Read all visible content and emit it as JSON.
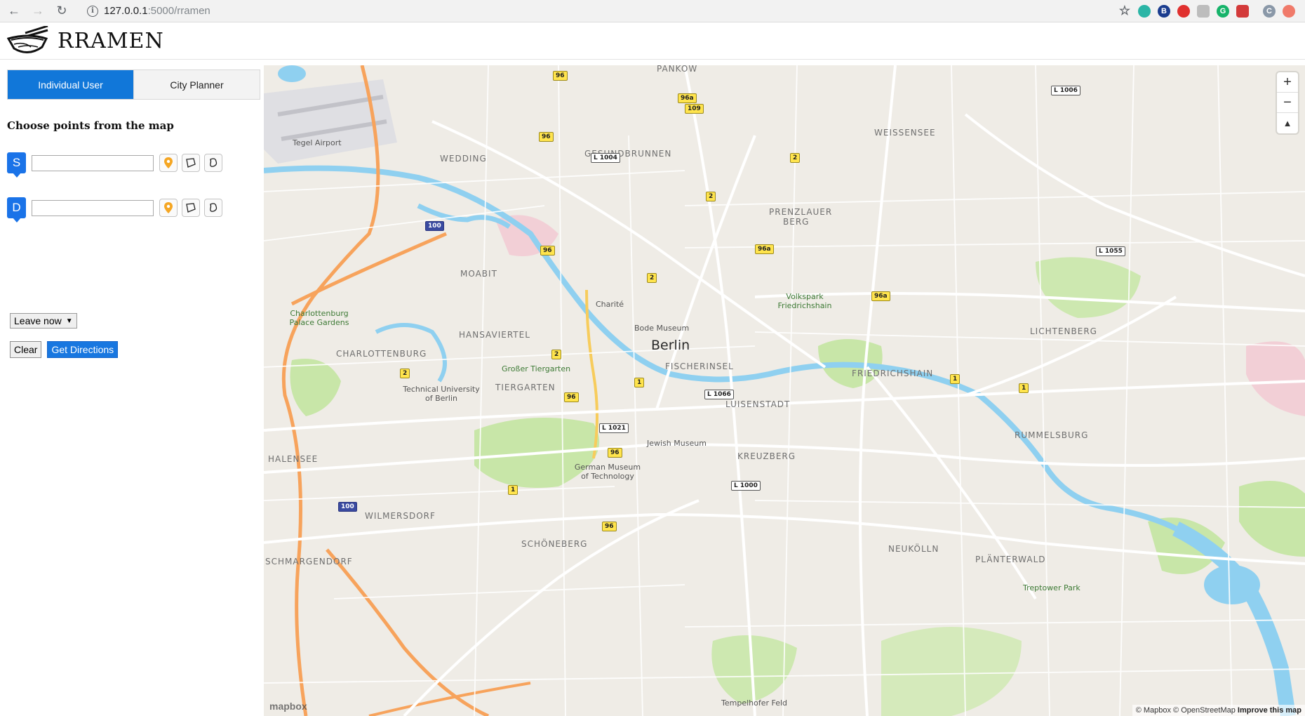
{
  "browser": {
    "url_host": "127.0.0.1",
    "url_path": ":5000/rramen",
    "profile_initial": "C"
  },
  "app": {
    "title": "RRAMEN"
  },
  "sidebar": {
    "tabs": [
      {
        "label": "Individual User"
      },
      {
        "label": "City Planner"
      }
    ],
    "section_title": "Choose points from the map",
    "start": {
      "marker": "S",
      "value": "",
      "placeholder": ""
    },
    "destination": {
      "marker": "D",
      "value": "",
      "placeholder": ""
    },
    "time_select": {
      "value": "Leave now"
    },
    "clear_label": "Clear",
    "directions_label": "Get Directions"
  },
  "map": {
    "labels": {
      "pankow": "PANKOW",
      "weissensee": "WEISSENSEE",
      "gesundbrunnen": "GESUNDBRUNNEN",
      "wedding": "WEDDING",
      "prenzlauer": "PRENZLAUER",
      "berg": "BERG",
      "moabit": "MOABIT",
      "charlottenburg": "CHARLOTTENBURG",
      "tiergarten": "TIERGARTEN",
      "berlin": "Berlin",
      "friedrichshain": "FRIEDRICHSHAIN",
      "kreuzberg": "KREUZBERG",
      "neukolln": "NEUKÖLLN",
      "schoneberg": "SCHÖNEBERG",
      "wilmersdorf": "WILMERSDORF",
      "lichtenberg": "LICHTENBERG",
      "rummelsburg": "RUMMELSBURG",
      "plänterwald": "PLÄNTERWALD",
      "halensee": "HALENSEE",
      "schmargendorf": "SCHMARGENDORF",
      "hansaviertel": "HANSAVIERTEL",
      "luisenstadt": "LUISENSTADT",
      "fischerinsel": "FISCHERINSEL",
      "tegel": "Tegel Airport",
      "charite": "Charité",
      "tiergarten_park": "Großer Tiergarten",
      "tu": "Technical University of Berlin",
      "volkspark": "Volkspark Friedrichshain",
      "treptower": "Treptower Park",
      "tempelhof": "Tempelhofer Feld",
      "charlottenburg_palace": "Charlottenburg Palace Gardens",
      "museum": "Bode Museum",
      "jewish": "Jewish Museum",
      "german_museum": "German Museum of Technology"
    },
    "attribution": "© Mapbox © OpenStreetMap",
    "improve": "Improve this map",
    "mapbox": "mapbox"
  }
}
